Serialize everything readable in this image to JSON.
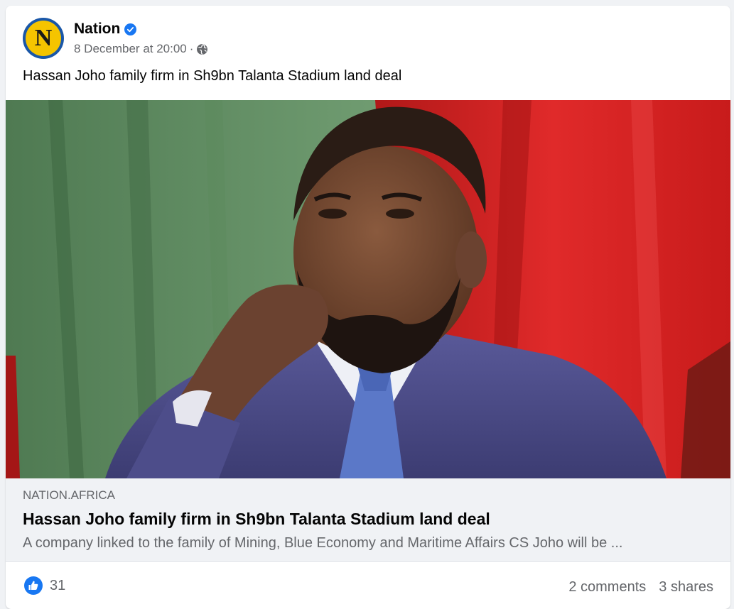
{
  "post": {
    "page_name": "Nation",
    "avatar_letter": "N",
    "timestamp": "8 December at 20:00",
    "separator": "·",
    "audience_icon": "globe-icon",
    "verified_icon": "verified-badge-icon",
    "text": "Hassan Joho family firm in Sh9bn Talanta Stadium land deal"
  },
  "link_preview": {
    "domain": "NATION.AFRICA",
    "title": "Hassan Joho family firm in Sh9bn Talanta Stadium land deal",
    "description": "A company linked to the family of Mining, Blue Economy and Maritime Affairs CS Joho will be ..."
  },
  "stats": {
    "reaction_icon": "like-icon",
    "reactions": "31",
    "comments": "2 comments",
    "shares": "3 shares"
  },
  "colors": {
    "accent": "#1877f2",
    "avatar_yellow": "#f5c400",
    "avatar_ring": "#1a57a8",
    "secondary_text": "#65676b",
    "preview_bg": "#f0f2f5"
  }
}
